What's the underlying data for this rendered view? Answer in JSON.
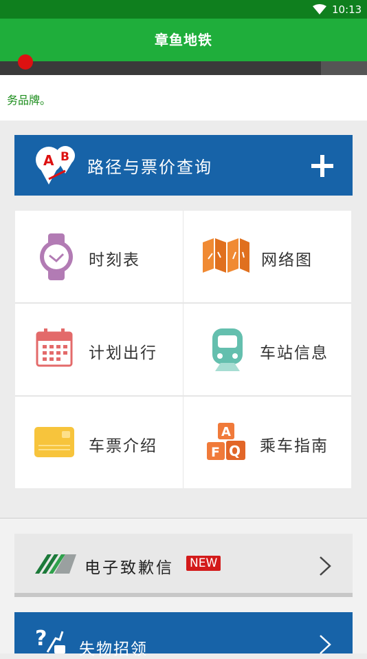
{
  "status_bar": {
    "time": "10:13",
    "wifi_icon": "wifi-icon"
  },
  "app_bar": {
    "title": "章鱼地铁"
  },
  "ticker": {
    "text": "务品牌。"
  },
  "route_query": {
    "label": "路径与票价查询",
    "icon": "ab-pin-icon",
    "action_icon": "plus-icon"
  },
  "grid": {
    "items": [
      {
        "label": "时刻表",
        "icon": "watch-icon"
      },
      {
        "label": "网络图",
        "icon": "map-icon"
      },
      {
        "label": "计划出行",
        "icon": "calendar-icon"
      },
      {
        "label": "车站信息",
        "icon": "train-icon"
      },
      {
        "label": "车票介绍",
        "icon": "card-icon"
      },
      {
        "label": "乘车指南",
        "icon": "faq-icon"
      }
    ]
  },
  "apology_letter": {
    "label": "电子致歉信",
    "badge": "NEW"
  },
  "lost_found": {
    "label": "失物招领"
  },
  "colors": {
    "status": "#0f7f1e",
    "app_bar": "#1fae3b",
    "blue_bar": "#1763a8",
    "badge": "#d31a1a"
  }
}
